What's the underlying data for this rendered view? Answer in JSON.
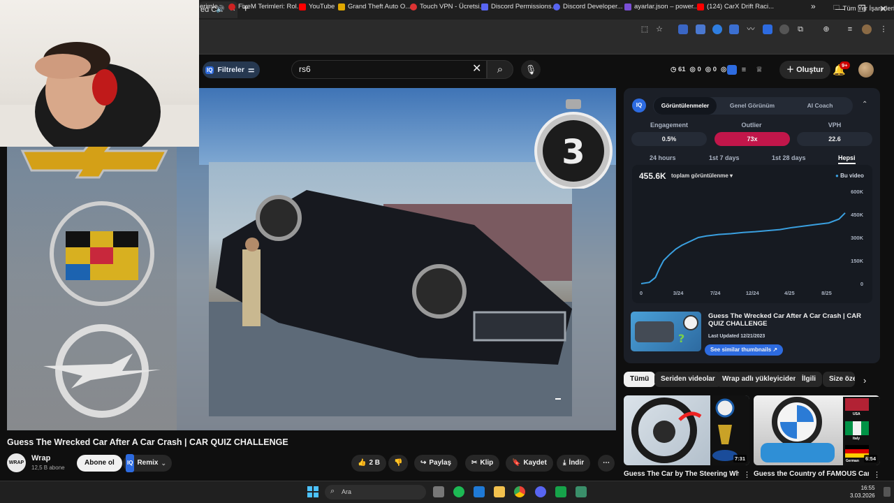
{
  "browser": {
    "tab_title": "ed C...",
    "window_controls": [
      "—",
      "❐",
      "✕"
    ],
    "bookmarks": [
      {
        "label": "erimle...",
        "color": "#888888"
      },
      {
        "label": "FiveM Terimleri: Rol...",
        "color": "#cc2222"
      },
      {
        "label": "YouTube",
        "color": "#ff0000"
      },
      {
        "label": "Grand Theft Auto O...",
        "color": "#e0a800"
      },
      {
        "label": "Touch VPN - Ücretsi...",
        "color": "#dd3333"
      },
      {
        "label": "Discord Permissions...",
        "color": "#5865f2"
      },
      {
        "label": "Discord Developer...",
        "color": "#5865f2"
      },
      {
        "label": "ayarlar.json – power...",
        "color": "#7a4fd6"
      },
      {
        "label": "(124) CarX Drift Raci...",
        "color": "#ff0000"
      }
    ],
    "bookmarks_overflow": "»",
    "all_bookmarks": "Tüm Yer İşaretleri"
  },
  "header": {
    "filters_label": "Filtreler",
    "search_value": "rs6",
    "stats": [
      "61",
      "0",
      "0",
      "0"
    ],
    "create_label": "Oluştur",
    "notif_count": "9+"
  },
  "player": {
    "countdown": "3"
  },
  "panel": {
    "tabs": [
      "Görüntülenmeler",
      "Genel Görünüm",
      "AI Coach"
    ],
    "metrics": [
      {
        "label": "Engagement",
        "value": "0.5%"
      },
      {
        "label": "Outlier",
        "value": "73x"
      },
      {
        "label": "VPH",
        "value": "22.6"
      }
    ],
    "ranges": [
      "24 hours",
      "1st 7 days",
      "1st 28 days",
      "Hepsi"
    ],
    "total": "455.6K",
    "total_label": "toplam görüntülenme",
    "legend": "Bu video",
    "related_title": "Guess The Wrecked Car After A Car Crash | CAR QUIZ CHALLENGE",
    "related_date": "Last Updated 12/21/2023",
    "similar_label": "See similar thumbnails"
  },
  "chart_data": {
    "type": "line",
    "x_ticks": [
      "0",
      "3/24",
      "7/24",
      "12/24",
      "4/25",
      "8/25"
    ],
    "y_ticks": [
      "0",
      "150K",
      "300K",
      "450K",
      "600K"
    ],
    "ylim": [
      0,
      600000
    ],
    "series": [
      {
        "name": "Bu video",
        "x": [
          0,
          0.04,
          0.07,
          0.09,
          0.11,
          0.14,
          0.17,
          0.2,
          0.24,
          0.28,
          0.32,
          0.38,
          0.44,
          0.5,
          0.56,
          0.62,
          0.68,
          0.74,
          0.8,
          0.86,
          0.92,
          0.97,
          1.0
        ],
        "values": [
          0,
          8000,
          40000,
          100000,
          150000,
          190000,
          225000,
          250000,
          275000,
          300000,
          310000,
          320000,
          325000,
          333000,
          338000,
          345000,
          352000,
          365000,
          375000,
          385000,
          395000,
          420000,
          460000
        ]
      }
    ],
    "colors": {
      "line": "#3aa0e0"
    }
  },
  "chips": [
    "Tümü",
    "Seriden videolar",
    "Wrap adlı yükleyiciden",
    "İlgili",
    "Size öze"
  ],
  "recommended": [
    {
      "title": "Guess The Car by The Steering Wheel |",
      "duration": "7:31"
    },
    {
      "title": "Guess the Country of FAMOUS Car",
      "duration": "6:54",
      "flag_labels": [
        "USA",
        "Italy",
        "German"
      ]
    }
  ],
  "video": {
    "title": "Guess The Wrecked Car After A Car Crash | CAR QUIZ CHALLENGE",
    "channel": "Wrap",
    "channel_avatar": "WRAP",
    "subscribers": "12,5 B abone",
    "subscribe_label": "Abone ol",
    "remix_label": "Remix",
    "likes": "2 B",
    "share_label": "Paylaş",
    "clip_label": "Klip",
    "save_label": "Kaydet",
    "download_label": "İndir"
  },
  "taskbar": {
    "search_placeholder": "Ara",
    "time": "16:55",
    "date": "3.03.2026"
  }
}
